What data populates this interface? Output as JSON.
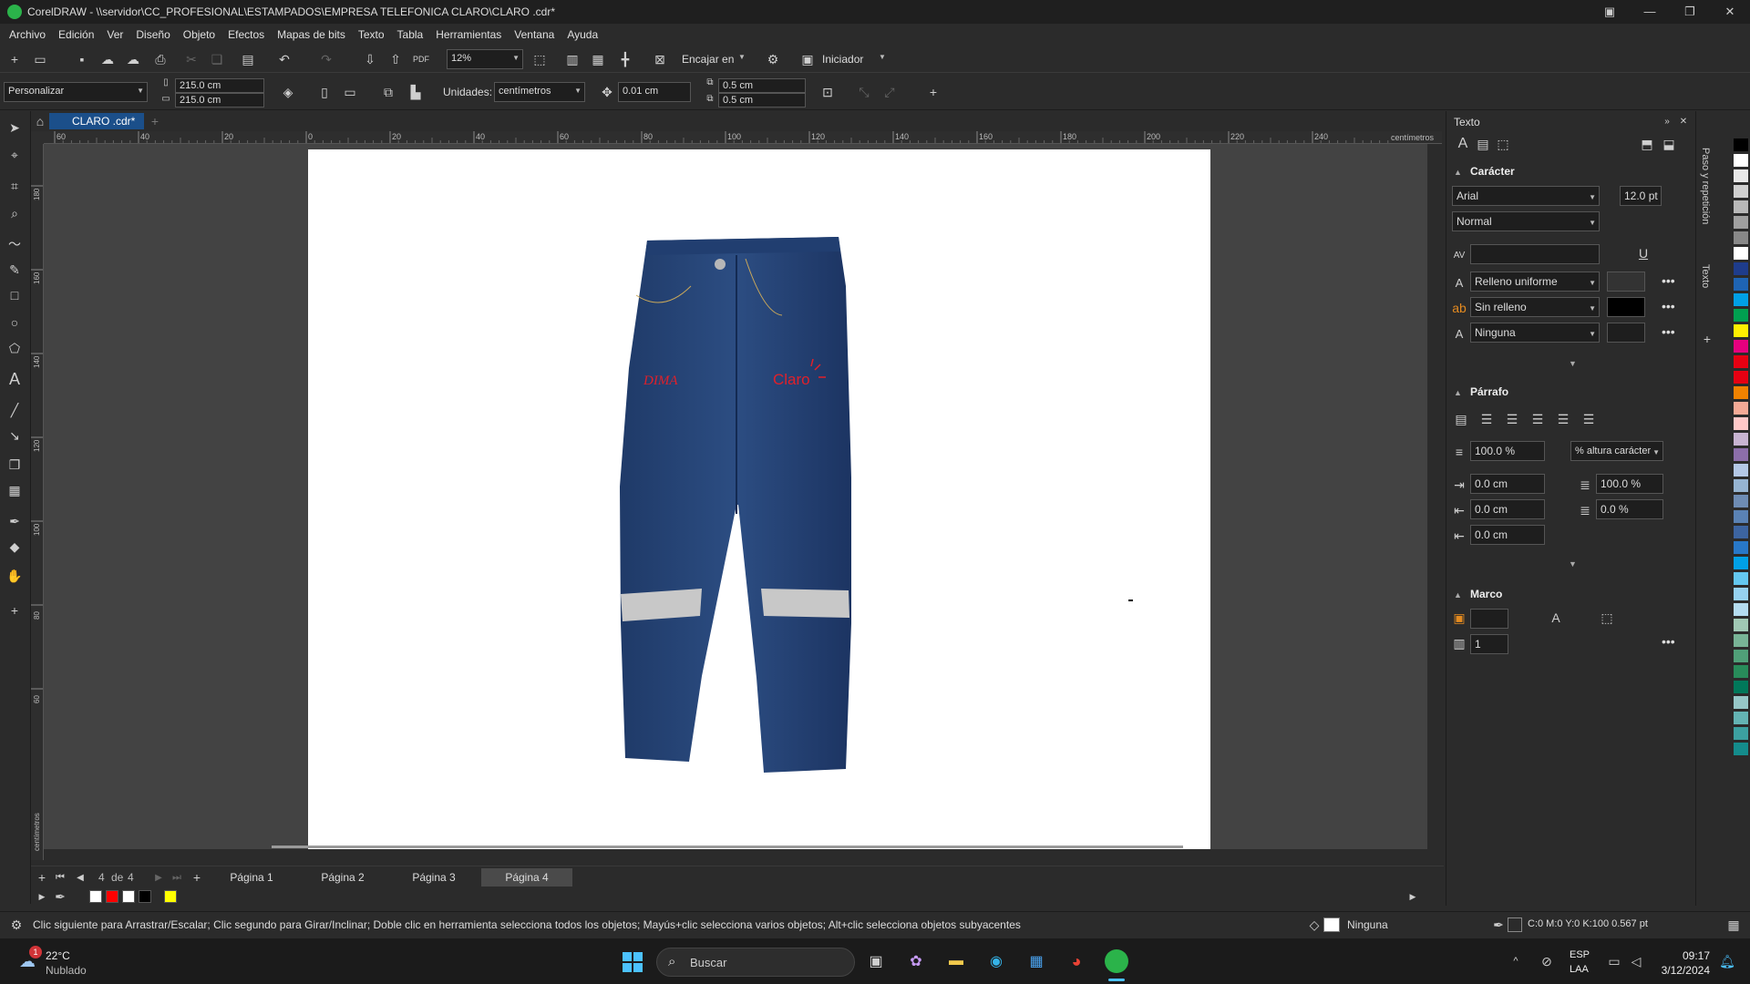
{
  "app": {
    "title": "CorelDRAW - \\\\servidor\\CC_PROFESIONAL\\ESTAMPADOS\\EMPRESA TELEFONICA CLARO\\CLARO .cdr*"
  },
  "menu": [
    "Archivo",
    "Edición",
    "Ver",
    "Diseño",
    "Objeto",
    "Efectos",
    "Mapas de bits",
    "Texto",
    "Tabla",
    "Herramientas",
    "Ventana",
    "Ayuda"
  ],
  "toolbar1": {
    "zoom": "12%",
    "snap": "Encajar en",
    "launcher": "Iniciador"
  },
  "toolbar2": {
    "preset": "Personalizar",
    "width": "215.0 cm",
    "height": "215.0 cm",
    "units_label": "Unidades:",
    "units": "centímetros",
    "nudge": "0.01 cm",
    "dup_x": "0.5 cm",
    "dup_y": "0.5 cm"
  },
  "doc": {
    "tab": "CLARO .cdr*"
  },
  "ruler": {
    "h_ticks": [
      "60",
      "40",
      "20",
      "0",
      "20",
      "40",
      "60",
      "80",
      "100",
      "120",
      "140",
      "160",
      "180",
      "200",
      "220",
      "240"
    ],
    "h_unit": "centímetros",
    "v_ticks": [
      "180",
      "160",
      "140",
      "120",
      "100",
      "80",
      "60"
    ],
    "v_unit": "centímetros"
  },
  "artwork": {
    "logo_left": "DIMA",
    "logo_right": "Claro"
  },
  "pages": {
    "counter": "4",
    "of": "de",
    "total": "4",
    "tabs": [
      "Página 1",
      "Página 2",
      "Página 3",
      "Página 4"
    ],
    "active": 3
  },
  "status": {
    "hint": "Clic siguiente para Arrastrar/Escalar; Clic segundo para Girar/Inclinar; Doble clic en herramienta selecciona todos los objetos; Mayús+clic selecciona varios objetos; Alt+clic selecciona objetos subyacentes",
    "fill": "Ninguna",
    "outline": "C:0 M:0 Y:0 K:100  0.567 pt"
  },
  "docker": {
    "title": "Texto",
    "character": {
      "header": "Carácter",
      "font": "Arial",
      "size": "12.0 pt",
      "style": "Normal",
      "fill_type": "Relleno uniforme",
      "bg_type": "Sin relleno",
      "outline_type": "Ninguna"
    },
    "paragraph": {
      "header": "Párrafo",
      "line_spacing": "100.0 %",
      "spacing_unit": "% altura carácter",
      "indent1": "0.0 cm",
      "indent2": "0.0 cm",
      "indent3": "0.0 cm",
      "char_spacing": "100.0 %",
      "word_spacing": "0.0 %"
    },
    "frame": {
      "header": "Marco",
      "columns": "1"
    }
  },
  "sidetabs": [
    "Paso y repetición",
    "Texto"
  ],
  "taskbar": {
    "temp": "22°C",
    "weather": "Nublado",
    "badge": "1",
    "search": "Buscar",
    "lang1": "ESP",
    "lang2": "LAA",
    "time": "09:17",
    "date": "3/12/2024"
  },
  "palette_colors": [
    "#ffffff",
    "#ff0000",
    "#ffffff",
    "#000000",
    "#ffff00"
  ],
  "side_palette": [
    "#000000",
    "#ffffff",
    "#e8e8e8",
    "#d0d0d0",
    "#b8b8b8",
    "#a0a0a0",
    "#888888",
    "#ffffff",
    "#1e3c8c",
    "#1e64b4",
    "#00a0e6",
    "#00a050",
    "#fff000",
    "#e6007e",
    "#e60012",
    "#e60012",
    "#f08200",
    "#f5aa96",
    "#ffc8c8",
    "#c8b4d2",
    "#8c6eaa",
    "#b4c8e6",
    "#96b4d2",
    "#6e8cb4",
    "#5a82b4",
    "#3c64a0",
    "#2878c8",
    "#00a0e6",
    "#64c8f0",
    "#96d2f0",
    "#b4dcf0",
    "#a0c8b4",
    "#78b496",
    "#50a078",
    "#288c5a",
    "#00785a",
    "#96c8c8",
    "#64b4b4",
    "#3ca0a0",
    "#148c8c"
  ]
}
